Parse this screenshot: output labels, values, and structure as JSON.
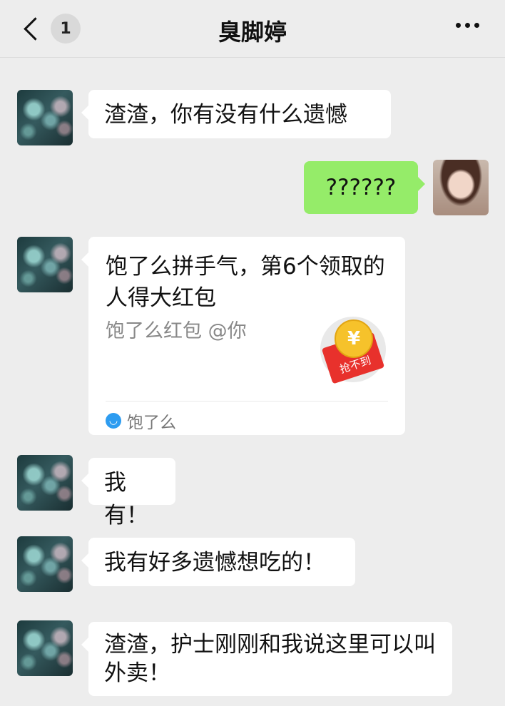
{
  "header": {
    "back_label": "<",
    "unread_count": "1",
    "title": "臭脚婷",
    "more_label": "..."
  },
  "messages": {
    "m1": {
      "text": "渣渣，你有没有什么遗憾"
    },
    "m2": {
      "text": "??????"
    },
    "m3": {
      "title": "饱了么拼手气，第6个领取的人得大红包",
      "subtitle": "饱了么红包 @你",
      "coin_symbol": "¥",
      "status": "抢不到",
      "app_name": "饱了么"
    },
    "m4": {
      "text": "我有！"
    },
    "m5": {
      "text": "我有好多遗憾想吃的！"
    },
    "m6": {
      "text": "渣渣，护士刚刚和我说这里可以叫外卖！"
    }
  },
  "colors": {
    "background": "#ededed",
    "self_bubble": "#95ec69",
    "other_bubble": "#ffffff",
    "red_packet": "#e8312c",
    "coin": "#f6c22b"
  }
}
